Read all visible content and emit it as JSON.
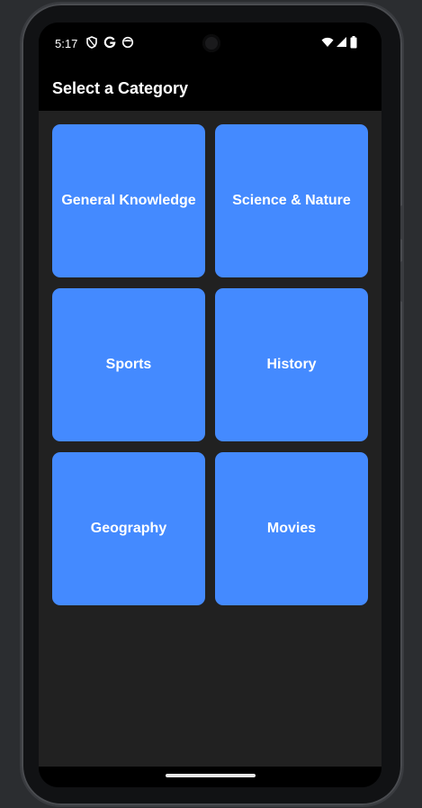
{
  "status_bar": {
    "time": "5:17",
    "left_icons": [
      "shield-icon",
      "google-g-icon",
      "face-icon"
    ],
    "right_icons": [
      "wifi-icon",
      "signal-icon",
      "battery-icon"
    ]
  },
  "app_bar": {
    "title": "Select a Category"
  },
  "categories": [
    {
      "label": "General Knowledge"
    },
    {
      "label": "Science & Nature"
    },
    {
      "label": "Sports"
    },
    {
      "label": "History"
    },
    {
      "label": "Geography"
    },
    {
      "label": "Movies"
    }
  ],
  "colors": {
    "tile": "#448aff",
    "background": "#212121",
    "app_bar": "#000000",
    "text": "#ffffff"
  }
}
